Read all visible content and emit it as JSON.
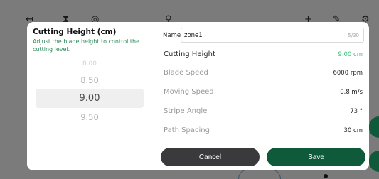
{
  "dialog": {
    "title": "Cutting Height (cm)",
    "subtitle": "Adjust the blade height to control the cutting level.",
    "picker": {
      "above_far": "8.00",
      "above": "8.50",
      "selected": "9.00",
      "below": "9.50"
    },
    "name_field": {
      "label": "Name",
      "value": "zone1",
      "count": "5/30"
    },
    "params": [
      {
        "label": "Cutting Height",
        "value": "9.00 cm"
      },
      {
        "label": "Blade Speed",
        "value": "6000 rpm"
      },
      {
        "label": "Moving Speed",
        "value": "0.8 m/s"
      },
      {
        "label": "Stripe Angle",
        "value": "73 °"
      },
      {
        "label": "Path Spacing",
        "value": "30 cm"
      }
    ],
    "buttons": {
      "cancel": "Cancel",
      "save": "Save"
    }
  },
  "colors": {
    "accent": "#3bc07a",
    "primary_button": "#0f5a3a",
    "cancel_button": "#3a3a3c"
  }
}
